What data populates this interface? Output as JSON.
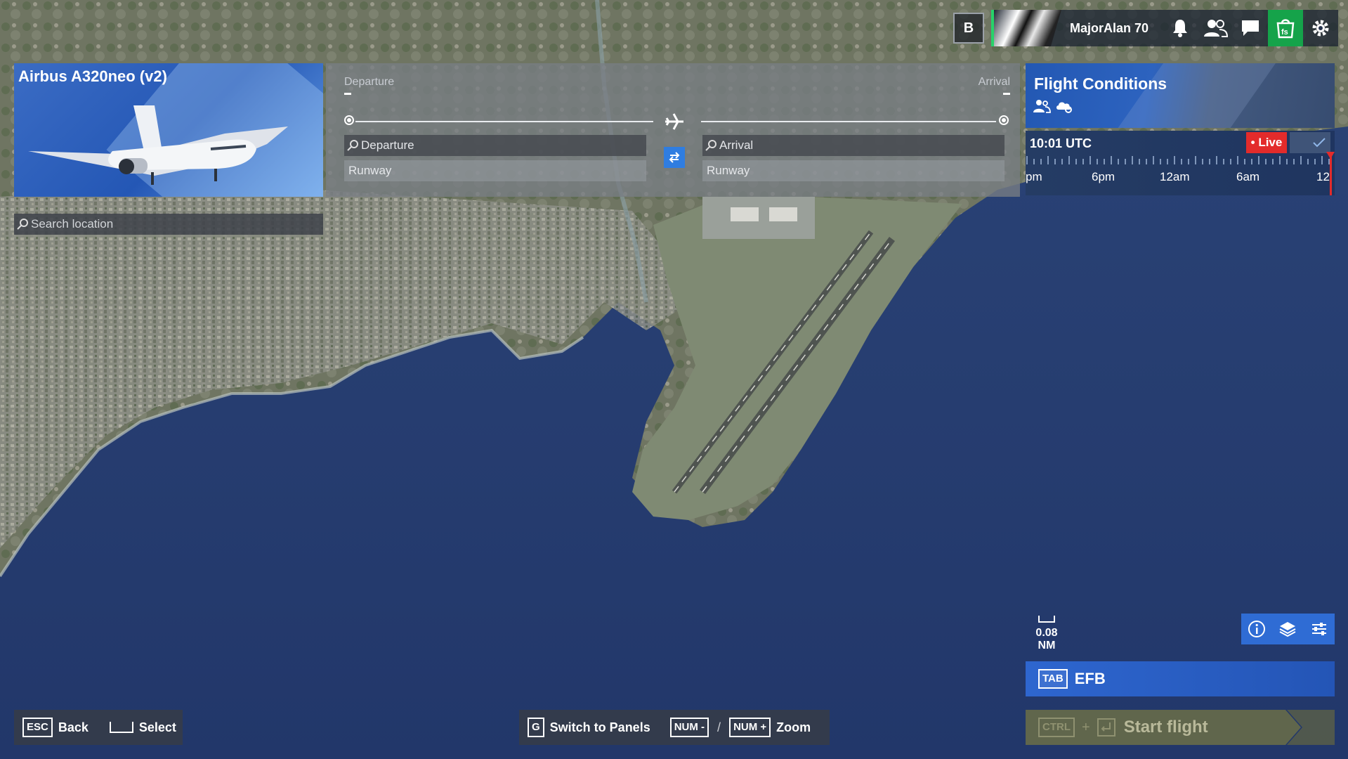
{
  "top_bar": {
    "badge_letter": "B",
    "username": "MajorAlan 70",
    "icons": [
      "bell-icon",
      "friends-icon",
      "chat-icon",
      "store-icon",
      "gear-icon"
    ],
    "store_color": "#15a34a"
  },
  "aircraft": {
    "name": "Airbus A320neo (v2)"
  },
  "route": {
    "departure_label": "Departure",
    "arrival_label": "Arrival",
    "departure_value": "-",
    "arrival_value": "-",
    "departure_placeholder": "Departure",
    "arrival_placeholder": "Arrival",
    "departure_runway": "Runway",
    "arrival_runway": "Runway"
  },
  "search": {
    "placeholder": "Search location"
  },
  "flight_conditions": {
    "title": "Flight Conditions",
    "time": "10:01 UTC",
    "live_label": "• Live",
    "timeline_labels": [
      "pm",
      "6pm",
      "12am",
      "6am",
      "12"
    ]
  },
  "map": {
    "scale_label": "0.08 NM"
  },
  "efb": {
    "key": "TAB",
    "label": "EFB"
  },
  "start_flight": {
    "key1": "CTRL",
    "plus": "+",
    "label": "Start flight"
  },
  "hints": {
    "back_key": "ESC",
    "back_label": "Back",
    "select_label": "Select",
    "panels_key": "G",
    "panels_label": "Switch to Panels",
    "zoom_out_key": "NUM -",
    "slash": "/",
    "zoom_in_key": "NUM +",
    "zoom_label": "Zoom"
  },
  "colors": {
    "live": "#e32b2b",
    "accent_blue": "#2f7de1"
  }
}
